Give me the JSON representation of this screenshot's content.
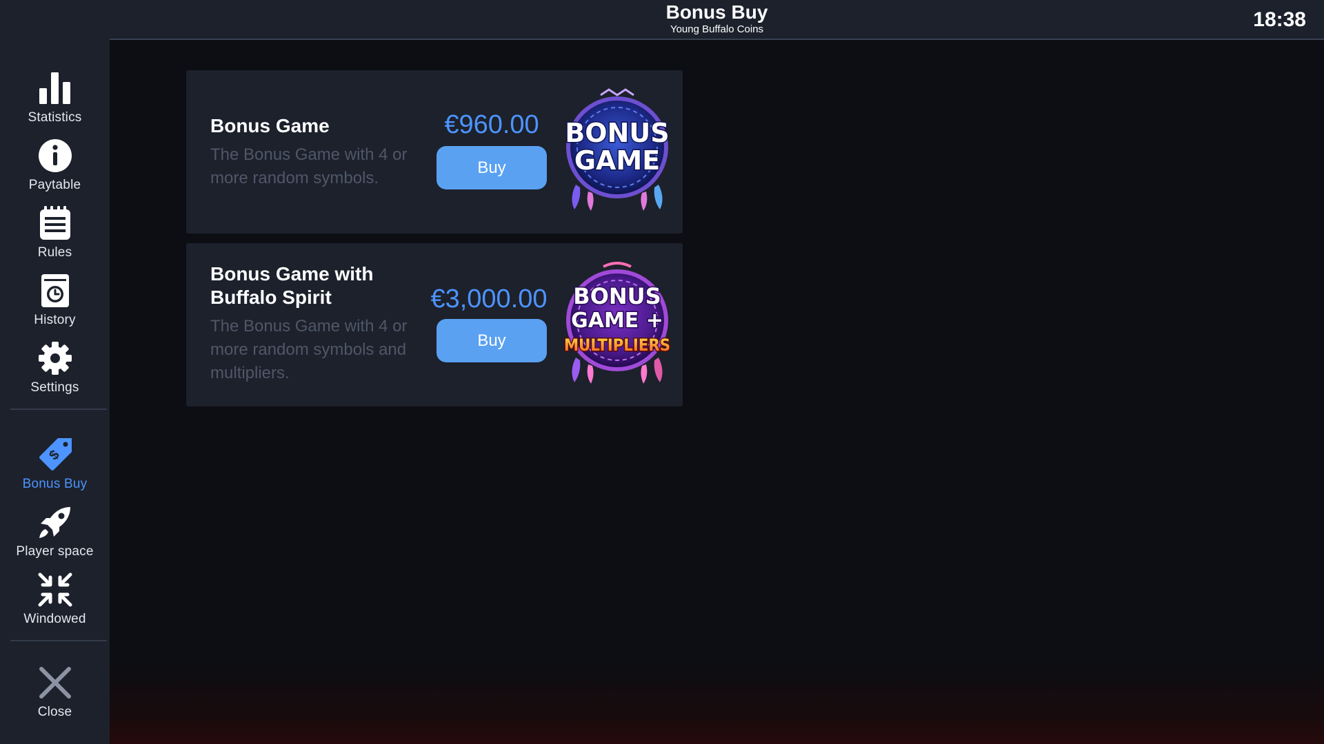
{
  "header": {
    "title": "Bonus Buy",
    "subtitle": "Young Buffalo Coins",
    "clock": "18:38"
  },
  "sidebar": {
    "items": [
      {
        "label": "Statistics",
        "icon": "bar-chart-icon"
      },
      {
        "label": "Paytable",
        "icon": "info-icon"
      },
      {
        "label": "Rules",
        "icon": "document-icon"
      },
      {
        "label": "History",
        "icon": "history-clock-icon"
      },
      {
        "label": "Settings",
        "icon": "gear-icon"
      },
      {
        "label": "Bonus Buy",
        "icon": "price-tag-icon",
        "active": true
      },
      {
        "label": "Player space",
        "icon": "rocket-icon"
      },
      {
        "label": "Windowed",
        "icon": "compress-arrows-icon"
      },
      {
        "label": "Close",
        "icon": "close-icon"
      }
    ]
  },
  "offers": [
    {
      "title": "Bonus Game",
      "description": "The Bonus Game with 4 or more random symbols.",
      "price": "€960.00",
      "button": "Buy",
      "badge_text": [
        "BONUS",
        "GAME"
      ]
    },
    {
      "title": "Bonus Game with Buffalo Spirit",
      "description": "The Bonus Game with 4 or more random symbols and multipliers.",
      "price": "€3,000.00",
      "button": "Buy",
      "badge_text": [
        "BONUS",
        "GAME +",
        "MULTIPLIERS"
      ]
    }
  ],
  "colors": {
    "accent": "#4d94ff",
    "button": "#5aa1f2",
    "panel": "#1c212c",
    "background": "#0c0e13"
  }
}
